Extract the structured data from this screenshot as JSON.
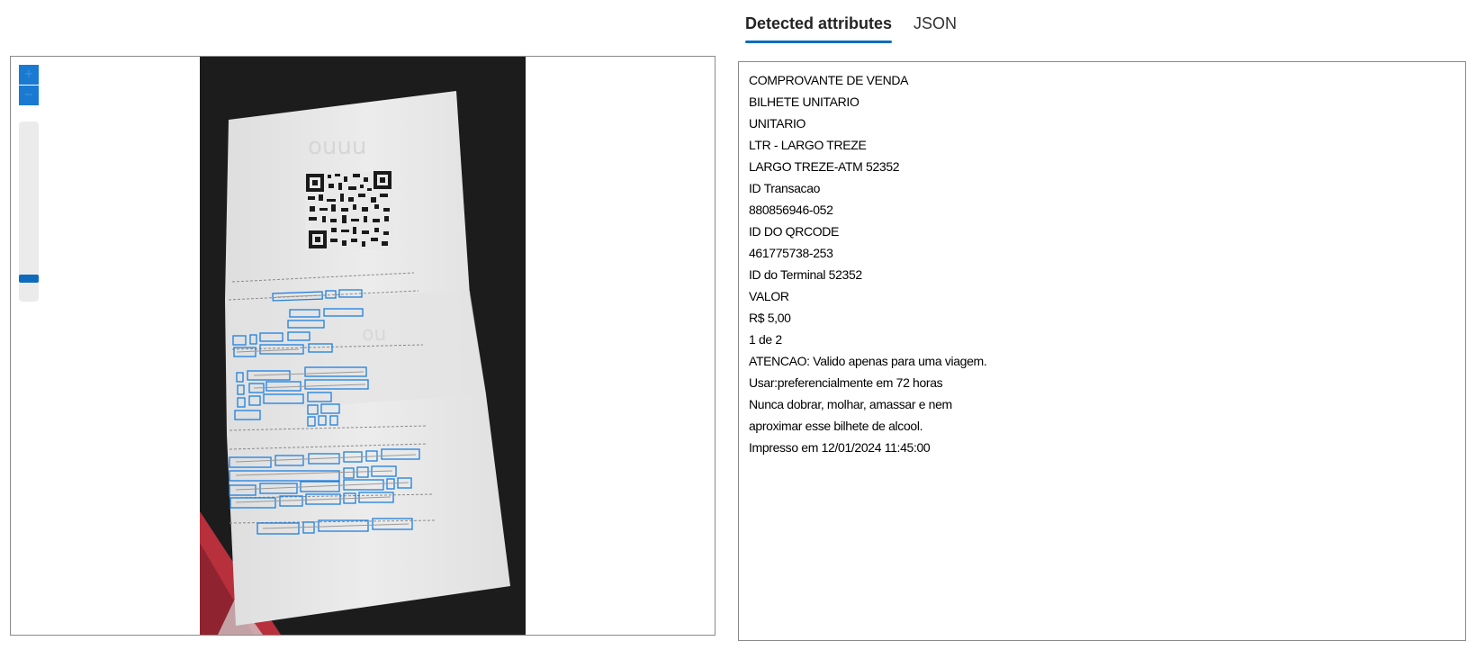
{
  "viewer": {
    "zoom_in_label": "+",
    "zoom_out_label": "−",
    "zoom_level": 0.05
  },
  "tabs": [
    {
      "label": "Detected attributes",
      "active": true
    },
    {
      "label": "JSON",
      "active": false
    }
  ],
  "lines": [
    "COMPROVANTE DE VENDA",
    "BILHETE UNITARIO",
    "UNITARIO",
    "LTR - LARGO TREZE",
    "LARGO TREZE-ATM 52352",
    "ID Transacao",
    "880856946-052",
    "ID DO QRCODE",
    "461775738-253",
    "ID do Terminal 52352",
    "VALOR",
    "R$ 5,00",
    "1 de 2",
    "ATENCAO: Valido apenas para uma viagem.",
    "Usar:preferencialmente em 72 horas",
    "Nunca dobrar, molhar, amassar e nem",
    "aproximar esse bilhete de alcool.",
    "Impresso em 12/01/2024 11:45:00"
  ],
  "colors": {
    "accent": "#0f6cbd",
    "bbox": "#1d7fe0",
    "photo_background": "#1c1c1c",
    "receipt_paper": "#e9e9e9"
  }
}
